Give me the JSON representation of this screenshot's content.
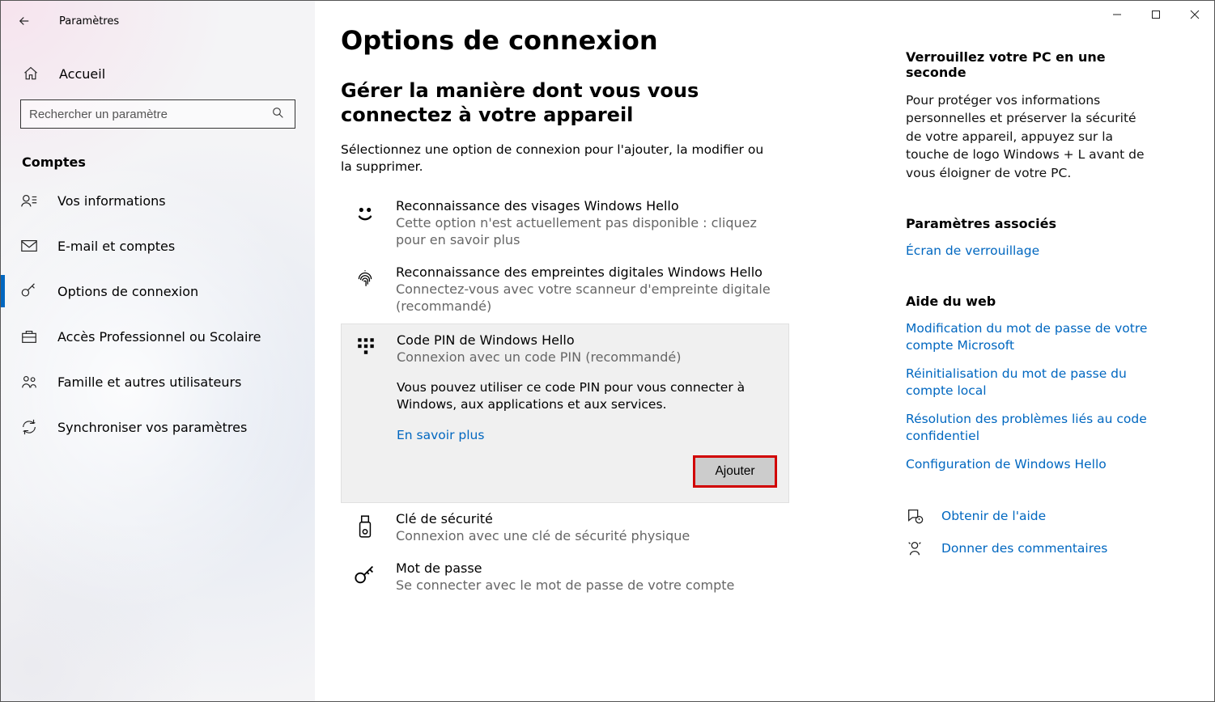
{
  "app_title": "Paramètres",
  "home_label": "Accueil",
  "search_placeholder": "Rechercher un paramètre",
  "section_header": "Comptes",
  "nav_items": [
    {
      "label": "Vos informations",
      "icon": "user-info-icon"
    },
    {
      "label": "E-mail et comptes",
      "icon": "email-icon"
    },
    {
      "label": "Options de connexion",
      "icon": "key-icon"
    },
    {
      "label": "Accès Professionnel ou Scolaire",
      "icon": "briefcase-icon"
    },
    {
      "label": "Famille et autres utilisateurs",
      "icon": "family-icon"
    },
    {
      "label": "Synchroniser vos paramètres",
      "icon": "sync-icon"
    }
  ],
  "page_title": "Options de connexion",
  "page_subtitle": "Gérer la manière dont vous vous connectez à votre appareil",
  "page_desc": "Sélectionnez une option de connexion pour l'ajouter, la modifier ou la supprimer.",
  "signin_options": [
    {
      "title": "Reconnaissance des visages Windows Hello",
      "sub": "Cette option n'est actuellement pas disponible : cliquez pour en savoir plus"
    },
    {
      "title": "Reconnaissance des empreintes digitales Windows Hello",
      "sub": "Connectez-vous avec votre scanneur d'empreinte digitale (recommandé)"
    },
    {
      "title": "Code PIN de Windows Hello",
      "sub": "Connexion avec un code PIN (recommandé)",
      "body": "Vous pouvez utiliser ce code PIN pour vous connecter à Windows, aux applications et aux services.",
      "link": "En savoir plus",
      "button": "Ajouter"
    },
    {
      "title": "Clé de sécurité",
      "sub": "Connexion avec une clé de sécurité physique"
    },
    {
      "title": "Mot de passe",
      "sub": "Se connecter avec le mot de passe de votre compte"
    }
  ],
  "right": {
    "lock_title": "Verrouillez votre PC en une seconde",
    "lock_text": "Pour protéger vos informations personnelles et préserver la sécurité de votre appareil, appuyez sur la touche de logo Windows + L avant de vous éloigner de votre PC.",
    "related_title": "Paramètres associés",
    "related_link": "Écran de verrouillage",
    "web_title": "Aide du web",
    "web_links": [
      "Modification du mot de passe de votre compte Microsoft",
      "Réinitialisation du mot de passe du compte local",
      "Résolution des problèmes liés au code confidentiel",
      "Configuration de Windows Hello"
    ],
    "help_link": "Obtenir de l'aide",
    "feedback_link": "Donner des commentaires"
  }
}
